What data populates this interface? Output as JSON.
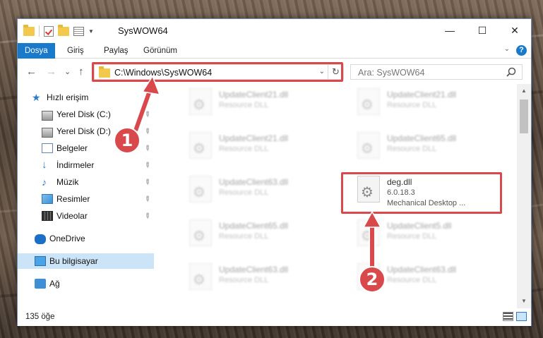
{
  "window": {
    "title": "SysWOW64",
    "caption_minimize": "—",
    "caption_maximize": "☐",
    "caption_close": "✕"
  },
  "ribbon": {
    "tabs": [
      {
        "label": "Dosya",
        "active": true
      },
      {
        "label": "Giriş",
        "active": false
      },
      {
        "label": "Paylaş",
        "active": false
      },
      {
        "label": "Görünüm",
        "active": false
      }
    ],
    "help": "?"
  },
  "nav": {
    "back": "←",
    "forward": "→",
    "recent": "⌄",
    "up": "↑",
    "address_path": "C:\\Windows\\SysWOW64",
    "refresh": "↻",
    "search_placeholder": "Ara: SysWOW64"
  },
  "sidebar": {
    "items": [
      {
        "label": "Hızlı erişim",
        "icon": "star-icon",
        "pinned": false
      },
      {
        "label": "Yerel Disk (C:)",
        "icon": "disk-icon",
        "pinned": true
      },
      {
        "label": "Yerel Disk (D:)",
        "icon": "disk-icon",
        "pinned": true
      },
      {
        "label": "Belgeler",
        "icon": "document-icon",
        "pinned": true
      },
      {
        "label": "İndirmeler",
        "icon": "download-icon",
        "pinned": true
      },
      {
        "label": "Müzik",
        "icon": "music-icon",
        "pinned": true
      },
      {
        "label": "Resimler",
        "icon": "pictures-icon",
        "pinned": true
      },
      {
        "label": "Videolar",
        "icon": "video-icon",
        "pinned": true
      },
      {
        "label": "OneDrive",
        "icon": "cloud-icon",
        "pinned": false
      },
      {
        "label": "Bu bilgisayar",
        "icon": "computer-icon",
        "pinned": false,
        "selected": true
      },
      {
        "label": "Ağ",
        "icon": "network-icon",
        "pinned": false
      }
    ],
    "pin_glyph": "📌"
  },
  "files": {
    "left_column": [
      {
        "name": "UpdateClient21.dll",
        "desc": "Resource DLL"
      },
      {
        "name": "UpdateClient21.dll",
        "desc": "Resource DLL"
      },
      {
        "name": "UpdateClient63.dll",
        "desc": "Resource DLL"
      },
      {
        "name": "UpdateClient65.dll",
        "desc": "Resource DLL"
      },
      {
        "name": "UpdateClient63.dll",
        "desc": "Resource DLL"
      }
    ],
    "right_column": [
      {
        "name": "UpdateClient21.dll",
        "desc": "Resource DLL"
      },
      {
        "name": "UpdateClient65.dll",
        "desc": "Resource DLL"
      },
      {
        "name": "UpdateClient5.dll",
        "desc": "Resource DLL"
      },
      {
        "name": "UpdateClient63.dll",
        "desc": "Resource DLL"
      }
    ],
    "highlighted": {
      "name": "deg.dll",
      "version": "6.0.18.3",
      "desc": "Mechanical Desktop ..."
    }
  },
  "status": {
    "count": "135 öğe"
  },
  "callouts": {
    "one": "1",
    "two": "2"
  },
  "colors": {
    "accent": "#1979ca",
    "highlight": "#d9494c",
    "selection": "#cce4f7"
  }
}
